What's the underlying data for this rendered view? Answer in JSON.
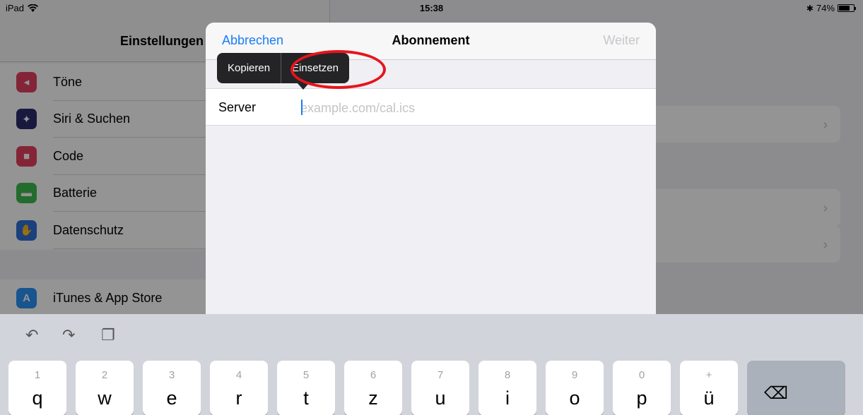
{
  "statusbar": {
    "device": "iPad",
    "time": "15:38",
    "battery_text": "74%"
  },
  "settings": {
    "title": "Einstellungen",
    "items": [
      {
        "label": "Töne",
        "icon": "sound-icon",
        "color": "#e4405f",
        "glyph": "◂"
      },
      {
        "label": "Siri & Suchen",
        "icon": "siri-icon",
        "color": "#2b2b6e",
        "glyph": "✦"
      },
      {
        "label": "Code",
        "icon": "lock-icon",
        "color": "#e4405f",
        "glyph": "🔒"
      },
      {
        "label": "Batterie",
        "icon": "battery-icon",
        "color": "#3ebb4e",
        "glyph": "▭"
      },
      {
        "label": "Datenschutz",
        "icon": "hand-icon",
        "color": "#2f6fd6",
        "glyph": "✋"
      }
    ],
    "items2": [
      {
        "label": "iTunes & App Store",
        "icon": "app-store-icon",
        "color": "#2a91f5",
        "glyph": "A"
      }
    ]
  },
  "sheet": {
    "cancel": "Abbrechen",
    "title": "Abonnement",
    "next": "Weiter",
    "field_label": "Server",
    "field_value": "",
    "field_placeholder": "example.com/cal.ics"
  },
  "edit_menu": {
    "copy": "Kopieren",
    "paste": "Einsetzen"
  },
  "keyboard": {
    "keys": [
      {
        "num": "1",
        "ch": "q"
      },
      {
        "num": "2",
        "ch": "w"
      },
      {
        "num": "3",
        "ch": "e"
      },
      {
        "num": "4",
        "ch": "r"
      },
      {
        "num": "5",
        "ch": "t"
      },
      {
        "num": "6",
        "ch": "z"
      },
      {
        "num": "7",
        "ch": "u"
      },
      {
        "num": "8",
        "ch": "i"
      },
      {
        "num": "9",
        "ch": "o"
      },
      {
        "num": "0",
        "ch": "p"
      },
      {
        "num": "+",
        "ch": "ü"
      }
    ],
    "delete_glyph": "⌫",
    "undo_glyph": "↶",
    "redo_glyph": "↷",
    "paste_glyph": "❐"
  },
  "colors": {
    "accent": "#1a7cf5",
    "highlight": "#e8141c"
  }
}
